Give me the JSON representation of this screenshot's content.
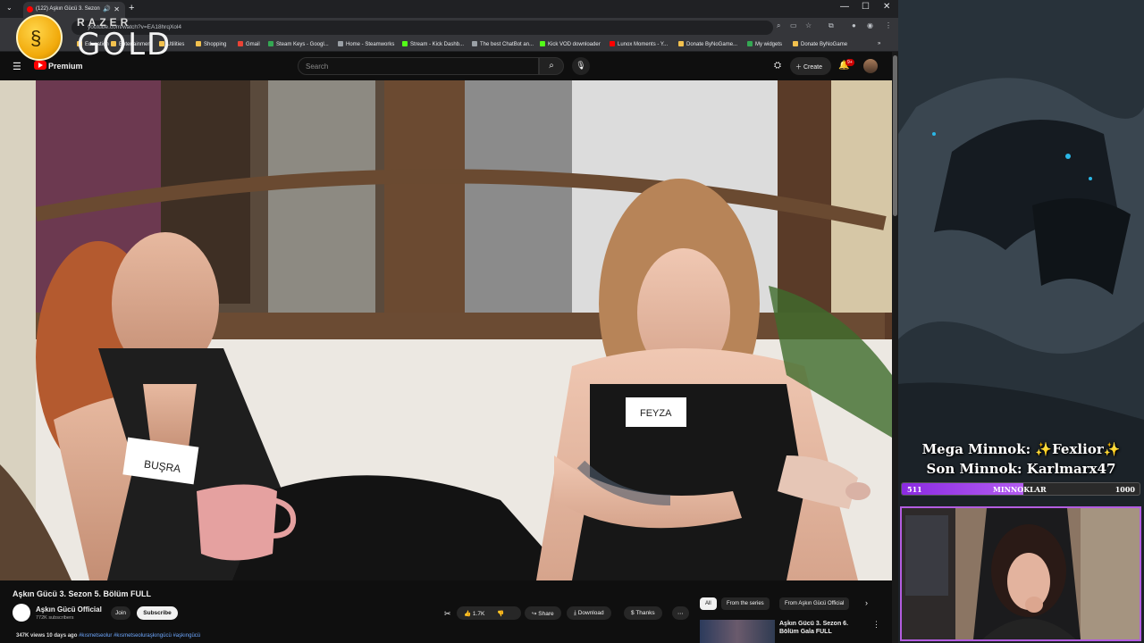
{
  "browser": {
    "tab_title": "(122) Aşkın Gücü 3. Sezon",
    "url": "youtube.com/watch?v=EA18hrqXol4",
    "bookmarks": [
      {
        "label": "Education",
        "color": "#f2c14e"
      },
      {
        "label": "Entertainment",
        "color": "#f2c14e"
      },
      {
        "label": "Utilities",
        "color": "#f2c14e"
      },
      {
        "label": "Shopping",
        "color": "#f2c14e"
      },
      {
        "label": "Gmail",
        "color": "#ea4335"
      },
      {
        "label": "Steam Keys - Googl...",
        "color": "#34a853"
      },
      {
        "label": "Home - Steamworks",
        "color": "#9aa0a6"
      },
      {
        "label": "Stream - Kick Dashb...",
        "color": "#53fc18"
      },
      {
        "label": "The best ChatBot an...",
        "color": "#9aa0a6"
      },
      {
        "label": "Kick VOD downloader",
        "color": "#53fc18"
      },
      {
        "label": "Lunox Moments - Y...",
        "color": "#ff0000"
      },
      {
        "label": "Donate ByNoGame...",
        "color": "#f2c14e"
      },
      {
        "label": "My widgets",
        "color": "#34a853"
      },
      {
        "label": "Donate ByNoGame",
        "color": "#f2c14e"
      }
    ]
  },
  "overlay": {
    "razer_label": "RAZER",
    "gold_label": "GOLD"
  },
  "youtube": {
    "premium_label": "Premium",
    "search_placeholder": "Search",
    "create_label": "Create",
    "notif_count": "9+",
    "video_title": "Aşkın Gücü 3. Sezon 5. Bölüm FULL",
    "channel_name": "Aşkın Gücü Official",
    "channel_subs": "772K subscribers",
    "join_label": "Join",
    "subscribe_label": "Subscribe",
    "like_count": "1.7K",
    "share_label": "Share",
    "download_label": "Download",
    "thanks_label": "Thanks",
    "views": "347K views",
    "date": "10 days ago",
    "tags": "#kısmetseolur #kısmetseoluraşkıngücü #aşkıngücü",
    "chips": [
      "All",
      "From the series",
      "From Aşkın Gücü Official"
    ],
    "rec_title": "Aşkın Gücü 3. Sezon 6. Bölüm Gala FULL",
    "name_tag_left": "BUŞRA",
    "name_tag_right": "FEYZA"
  },
  "stream": {
    "mega_minnok": "Mega Minnok: ✨Fexlior✨",
    "son_minnok": "Son Minnok: Karlmarx47",
    "goal_current": "511",
    "goal_label": "MINNOKLAR",
    "goal_target": "1000",
    "goal_progress": 0.511
  }
}
